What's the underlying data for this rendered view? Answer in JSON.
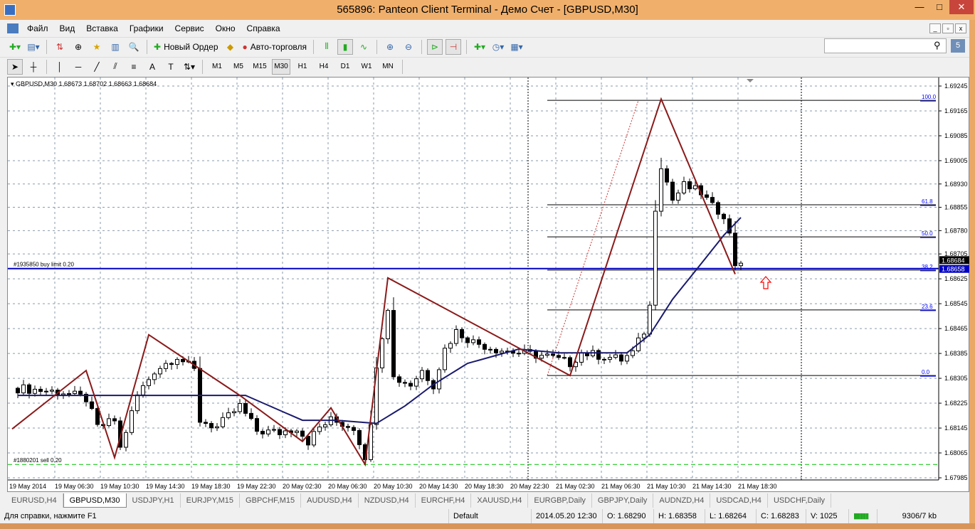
{
  "window": {
    "title": "565896: Panteon Client Terminal - Демо Счет - [GBPUSD,M30]",
    "min": "—",
    "max": "□",
    "close": "✕"
  },
  "menu": [
    "Файл",
    "Вид",
    "Вставка",
    "Графики",
    "Сервис",
    "Окно",
    "Справка"
  ],
  "toolbar": {
    "new_order": "Новый Ордер",
    "autotrading": "Авто-торговля",
    "search_placeholder": "",
    "badge": "5"
  },
  "timeframes": [
    "M1",
    "M5",
    "M15",
    "M30",
    "H1",
    "H4",
    "D1",
    "W1",
    "MN"
  ],
  "active_timeframe": "M30",
  "chart_data": {
    "type": "candlestick",
    "header": "GBPUSD,M30  1.68673 1.68702 1.68663 1.68684",
    "ylim": [
      1.67985,
      1.69245
    ],
    "price_ticks": [
      "1.69245",
      "1.69165",
      "1.69085",
      "1.69005",
      "1.68930",
      "1.68855",
      "1.68780",
      "1.68705",
      "1.68625",
      "1.68545",
      "1.68465",
      "1.68385",
      "1.68305",
      "1.68225",
      "1.68145",
      "1.68065",
      "1.67985"
    ],
    "time_ticks": [
      "19 May 2014",
      "19 May 06:30",
      "19 May 10:30",
      "19 May 14:30",
      "19 May 18:30",
      "19 May 22:30",
      "20 May 02:30",
      "20 May 06:30",
      "20 May 10:30",
      "20 May 14:30",
      "20 May 18:30",
      "20 May 22:30",
      "21 May 02:30",
      "21 May 06:30",
      "21 May 10:30",
      "21 May 14:30",
      "21 May 18:30"
    ],
    "bar_count": 128,
    "close_keypoints": [
      [
        0,
        1.68273
      ],
      [
        8,
        1.6826
      ],
      [
        12,
        1.68239
      ],
      [
        14,
        1.68147
      ],
      [
        17,
        1.6817
      ],
      [
        18,
        1.68079
      ],
      [
        21,
        1.6825
      ],
      [
        24,
        1.6833
      ],
      [
        28,
        1.68376
      ],
      [
        31,
        1.6833
      ],
      [
        32,
        1.6817
      ],
      [
        35,
        1.68147
      ],
      [
        39,
        1.68216
      ],
      [
        42,
        1.68136
      ],
      [
        46,
        1.6813
      ],
      [
        49,
        1.68147
      ],
      [
        51,
        1.68102
      ],
      [
        53,
        1.68147
      ],
      [
        55,
        1.6817
      ],
      [
        59,
        1.68147
      ],
      [
        61,
        1.68056
      ],
      [
        62,
        1.68147
      ],
      [
        63,
        1.68353
      ],
      [
        65,
        1.68536
      ],
      [
        66,
        1.68307
      ],
      [
        69,
        1.68285
      ],
      [
        71,
        1.6833
      ],
      [
        73,
        1.68285
      ],
      [
        75,
        1.68399
      ],
      [
        77,
        1.68456
      ],
      [
        80,
        1.68422
      ],
      [
        84,
        1.68399
      ],
      [
        88,
        1.68387
      ],
      [
        93,
        1.68376
      ],
      [
        97,
        1.68353
      ],
      [
        99,
        1.68387
      ],
      [
        103,
        1.68376
      ],
      [
        106,
        1.68365
      ],
      [
        108,
        1.68387
      ],
      [
        110,
        1.68456
      ],
      [
        111,
        1.68536
      ],
      [
        112,
        1.68856
      ],
      [
        113,
        1.68993
      ],
      [
        115,
        1.68879
      ],
      [
        117,
        1.68925
      ],
      [
        120,
        1.68902
      ],
      [
        122,
        1.68856
      ],
      [
        124,
        1.68833
      ],
      [
        125,
        1.68765
      ],
      [
        126,
        1.68673
      ],
      [
        127,
        1.68684
      ]
    ],
    "ma_keypoints": [
      [
        0,
        1.6825
      ],
      [
        40,
        1.6825
      ],
      [
        50,
        1.6817
      ],
      [
        56,
        1.6817
      ],
      [
        63,
        1.6816
      ],
      [
        68,
        1.68216
      ],
      [
        73,
        1.68285
      ],
      [
        79,
        1.68353
      ],
      [
        88,
        1.68399
      ],
      [
        95,
        1.68387
      ],
      [
        107,
        1.68387
      ],
      [
        111,
        1.68445
      ],
      [
        115,
        1.68559
      ],
      [
        120,
        1.68673
      ],
      [
        124,
        1.68765
      ],
      [
        127,
        1.68822
      ]
    ],
    "zigzag": [
      [
        -1,
        1.68142
      ],
      [
        12,
        1.6833
      ],
      [
        17,
        1.6805
      ],
      [
        23,
        1.68445
      ],
      [
        39,
        1.6825
      ],
      [
        50,
        1.68102
      ],
      [
        55,
        1.6821
      ],
      [
        61,
        1.68028
      ],
      [
        65,
        1.68628
      ],
      [
        97,
        1.68314
      ],
      [
        113,
        1.69203
      ],
      [
        126,
        1.6864
      ]
    ],
    "fibo": {
      "from_bar": 93,
      "to_bar": 162,
      "levels": [
        {
          "label": "100.0",
          "price": 1.69199
        },
        {
          "label": "61.8",
          "price": 1.68863
        },
        {
          "label": "50.0",
          "price": 1.6876
        },
        {
          "label": "38.2",
          "price": 1.68653
        },
        {
          "label": "23.6",
          "price": 1.68525
        },
        {
          "label": "0.0",
          "price": 1.68314
        }
      ],
      "trend": [
        [
          93,
          1.68314
        ],
        [
          109,
          1.69199
        ]
      ]
    },
    "orders": [
      {
        "label": "#1935850 buy limit 0.20",
        "price": 1.68658,
        "color": "#0000c0",
        "tag": "1.68658"
      },
      {
        "label": "#1880201 sell 0.20",
        "price": 1.68028,
        "color": "#00c000"
      }
    ],
    "bid": {
      "price": 1.68684,
      "tag": "1.68684"
    },
    "colors": {
      "zigzag": "#8b1a1a",
      "ma": "#1a1a6e",
      "fibo": "#0000ff",
      "arrow": "#ff0000"
    }
  },
  "tabs": [
    "EURUSD,H4",
    "GBPUSD,M30",
    "USDJPY,H1",
    "EURJPY,M15",
    "GBPCHF,M15",
    "AUDUSD,H4",
    "NZDUSD,H4",
    "EURCHF,H4",
    "XAUUSD,H4",
    "EURGBP,Daily",
    "GBPJPY,Daily",
    "AUDNZD,H4",
    "USDCAD,H4",
    "USDCHF,Daily"
  ],
  "active_tab": 1,
  "status": {
    "help": "Для справки, нажмите F1",
    "profile": "Default",
    "time": "2014.05.20 12:30",
    "open": "O: 1.68290",
    "high": "H: 1.68358",
    "low": "L: 1.68264",
    "close": "C: 1.68283",
    "volume": "V: 1025",
    "traffic": "9306/7 kb"
  }
}
